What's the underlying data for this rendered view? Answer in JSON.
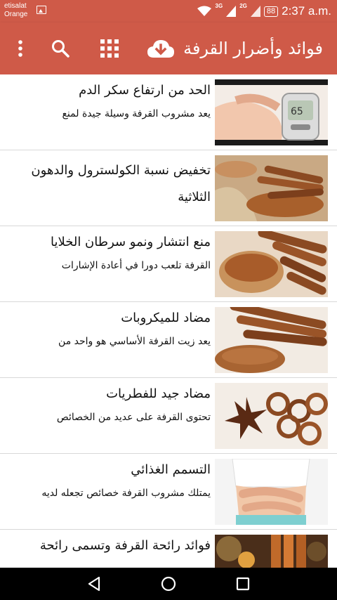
{
  "status_bar": {
    "carrier_line1": "etisalat",
    "carrier_line2": "Orange",
    "network_3g": "3G",
    "network_2g": "2G",
    "battery": "88",
    "time": "2:37 a.m."
  },
  "toolbar": {
    "title": "فوائد وأضرار القرفة",
    "icons": [
      "more-vert-icon",
      "search-icon",
      "grid-icon",
      "cloud-download-icon"
    ],
    "background": "#cf5a48"
  },
  "articles": [
    {
      "title": "الحد من ارتفاع سكر الدم",
      "summary": "يعد مشروب القرفة وسيلة جيدة  لمنع",
      "image": "blood-glucose-meter-image"
    },
    {
      "title": " تخفيض نسبة الكولسترول والدهون الثلاثية",
      "summary": "",
      "image": "cinnamon-sticks-sack-image"
    },
    {
      "title": "منع انتشار ونمو سرطان الخلايا",
      "summary": "القرفة تلعب دورا في أعادة الإشارات",
      "image": "cinnamon-powder-spoon-image"
    },
    {
      "title": "مضاد للميكروبات",
      "summary": "يعد زيت القرفة الأساسي هو واحد من",
      "image": "cinnamon-powder-sticks-image"
    },
    {
      "title": "مضاد جيد للفطريات",
      "summary": "تحتوى القرفة على عديد من الخصائص",
      "image": "star-anise-cinnamon-image"
    },
    {
      "title": "التسمم الغذائي",
      "summary": "يمتلك مشروب القرفة خصائص تجعله لديه",
      "image": "stomach-pain-image"
    },
    {
      "title": "فوائد رائحة القرفة وتسمى رائحة",
      "summary": "",
      "image": "cinnamon-pine-cones-image"
    }
  ],
  "nav_bar": {
    "icons": [
      "back-icon",
      "home-icon",
      "recents-icon"
    ]
  }
}
